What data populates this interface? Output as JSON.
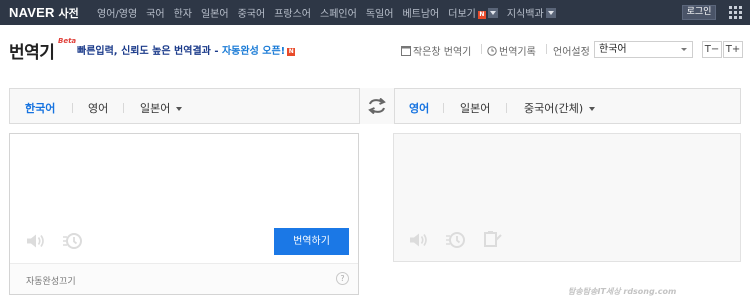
{
  "topbar": {
    "brand": "NAVER",
    "service": "사전",
    "menu": [
      "영어/영영",
      "국어",
      "한자",
      "일본어",
      "중국어",
      "프랑스어",
      "스페인어",
      "독일어",
      "베트남어",
      "더보기",
      "지식백과"
    ],
    "new_badge": "N",
    "login": "로그인"
  },
  "header": {
    "title": "번역기",
    "beta": "Beta",
    "notice_text": "빠른입력, 신뢰도 높은 번역결과 - ",
    "notice_highlight": "자동완성 오픈!",
    "notice_new": "N",
    "small_window": "작은창 번역기",
    "history": "번역기록",
    "lang_setting_label": "언어설정",
    "lang_setting_value": "한국어",
    "font_minus": "T−",
    "font_plus": "T+"
  },
  "source_langs": [
    {
      "label": "한국어",
      "active": true
    },
    {
      "label": "영어",
      "active": false
    },
    {
      "label": "일본어",
      "active": false
    }
  ],
  "target_langs": [
    {
      "label": "영어",
      "active": true
    },
    {
      "label": "일본어",
      "active": false
    },
    {
      "label": "중국어(간체)",
      "active": false
    }
  ],
  "source": {
    "input_value": "",
    "translate_button": "번역하기",
    "autocomplete_off": "자동완성끄기",
    "help": "?"
  },
  "watermark": "탐송탐송IT세상 rdsong.com",
  "colors": {
    "topbar": "#2e3746",
    "accent_blue": "#1b78e6",
    "active_tab": "#1673e0",
    "notice_blue": "#1a3a8a",
    "new_badge": "#e84a2a"
  }
}
